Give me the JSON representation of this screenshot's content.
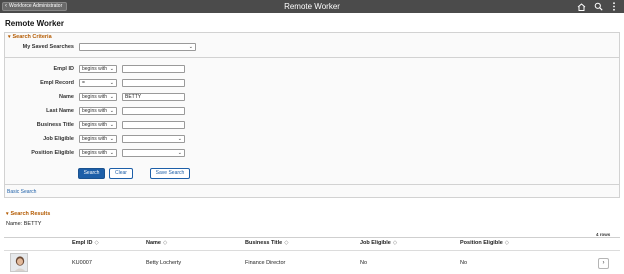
{
  "topbar": {
    "back_label": "Workforce Administrator",
    "title": "Remote Worker",
    "icons": [
      "home-icon",
      "search-icon",
      "more-vertical-icon"
    ]
  },
  "page": {
    "title": "Remote Worker"
  },
  "criteria": {
    "header": "Search Criteria",
    "saved_label": "My Saved Searches",
    "saved_value": "",
    "fields": [
      {
        "label": "Empl ID",
        "operator": "begins with",
        "value": "",
        "kind": "text"
      },
      {
        "label": "Empl Record",
        "operator": "=",
        "value": "",
        "kind": "text"
      },
      {
        "label": "Name",
        "operator": "begins with",
        "value": "BETTY",
        "kind": "text"
      },
      {
        "label": "Last Name",
        "operator": "begins with",
        "value": "",
        "kind": "text"
      },
      {
        "label": "Business Title",
        "operator": "begins with",
        "value": "",
        "kind": "text"
      },
      {
        "label": "Job Eligible",
        "operator": "begins with",
        "value": "",
        "kind": "select"
      },
      {
        "label": "Position Eligible",
        "operator": "begins with",
        "value": "",
        "kind": "select"
      }
    ],
    "buttons": {
      "search": "Search",
      "clear": "Clear",
      "save_search": "Save Search"
    },
    "basic_search": "Basic Search"
  },
  "results": {
    "header": "Search Results",
    "filter_text": "Name: BETTY",
    "row_count": "4 rows",
    "columns": [
      "Empl ID",
      "Name",
      "Business Title",
      "Job Eligible",
      "Position Eligible"
    ],
    "rows": [
      {
        "empl_id": "KU0007",
        "name": "Betty Locherty",
        "title": "Finance Director",
        "job_eligible": "No",
        "position_eligible": "No"
      }
    ]
  },
  "colors": {
    "topbar": "#4b4b4b",
    "primary": "#1d5fa8",
    "section_header": "#b35a00"
  }
}
